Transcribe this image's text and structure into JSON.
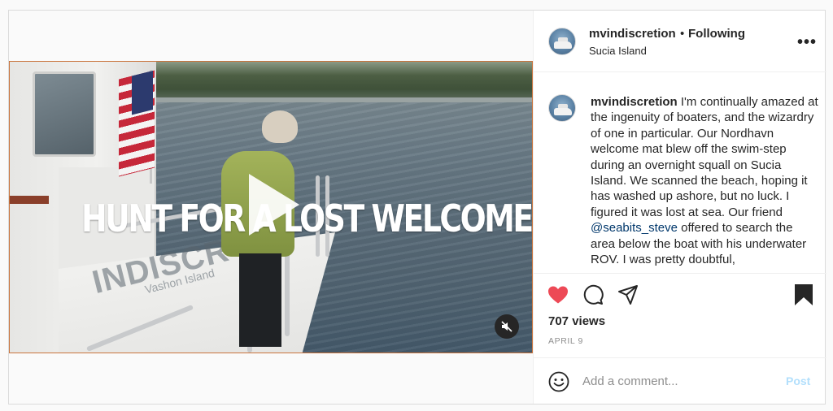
{
  "post": {
    "video": {
      "overlay_text": "HUNT FOR A LOST WELCOME MAT",
      "boat_name": "INDISCR",
      "boat_home": "Vashon Island"
    },
    "header": {
      "username": "mvindiscretion",
      "separator": "•",
      "follow_status": "Following",
      "location": "Sucia Island"
    },
    "caption": {
      "username": "mvindiscretion",
      "text_before_mention": " I'm continually amazed at the ingenuity of boaters, and the wizardry of one in particular. Our Nordhavn welcome mat blew off the swim-step during an overnight squall on Sucia Island. We scanned the beach, hoping it has washed up ashore, but no luck. I figured it was lost at sea. Our friend ",
      "mention": "@seabits_steve",
      "text_after_mention": " offered to search the area below the boat with his underwater ROV. I was pretty doubtful,"
    },
    "stats": {
      "views": "707 views",
      "date": "APRIL 9",
      "liked": true
    },
    "comment": {
      "placeholder": "Add a comment...",
      "post_label": "Post"
    },
    "colors": {
      "like": "#ed4956",
      "mention": "#00376b",
      "post_disabled": "#b2dffc"
    },
    "icons": [
      "heart-icon",
      "comment-icon",
      "share-icon",
      "bookmark-icon",
      "emoji-icon",
      "more-icon",
      "mute-icon",
      "play-icon"
    ]
  }
}
